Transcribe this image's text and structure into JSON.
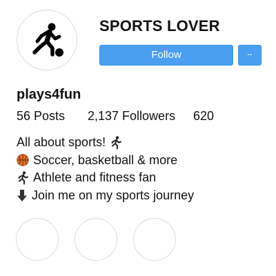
{
  "profile": {
    "display_name": "SPORTS LOVER",
    "username": "plays4fun",
    "avatar_icon": "soccer-player-icon"
  },
  "actions": {
    "follow_label": "Follow",
    "more_label": "··",
    "button_color": "#4a9ff0"
  },
  "stats": {
    "posts": "56 Posts",
    "followers": "2,137 Followers",
    "following": "620"
  },
  "bio": {
    "line1": "All about sports!",
    "line1_icon": "running-person-icon",
    "line2": "Soccer, basketball & more",
    "line2_icon": "basketball-icon",
    "line3": "Athlete and fitness fan",
    "line3_icon": "running-person-icon",
    "line4": "Join me on my sports journey",
    "line4_icon": "down-arrow-icon"
  },
  "highlights": {
    "count": 3
  }
}
